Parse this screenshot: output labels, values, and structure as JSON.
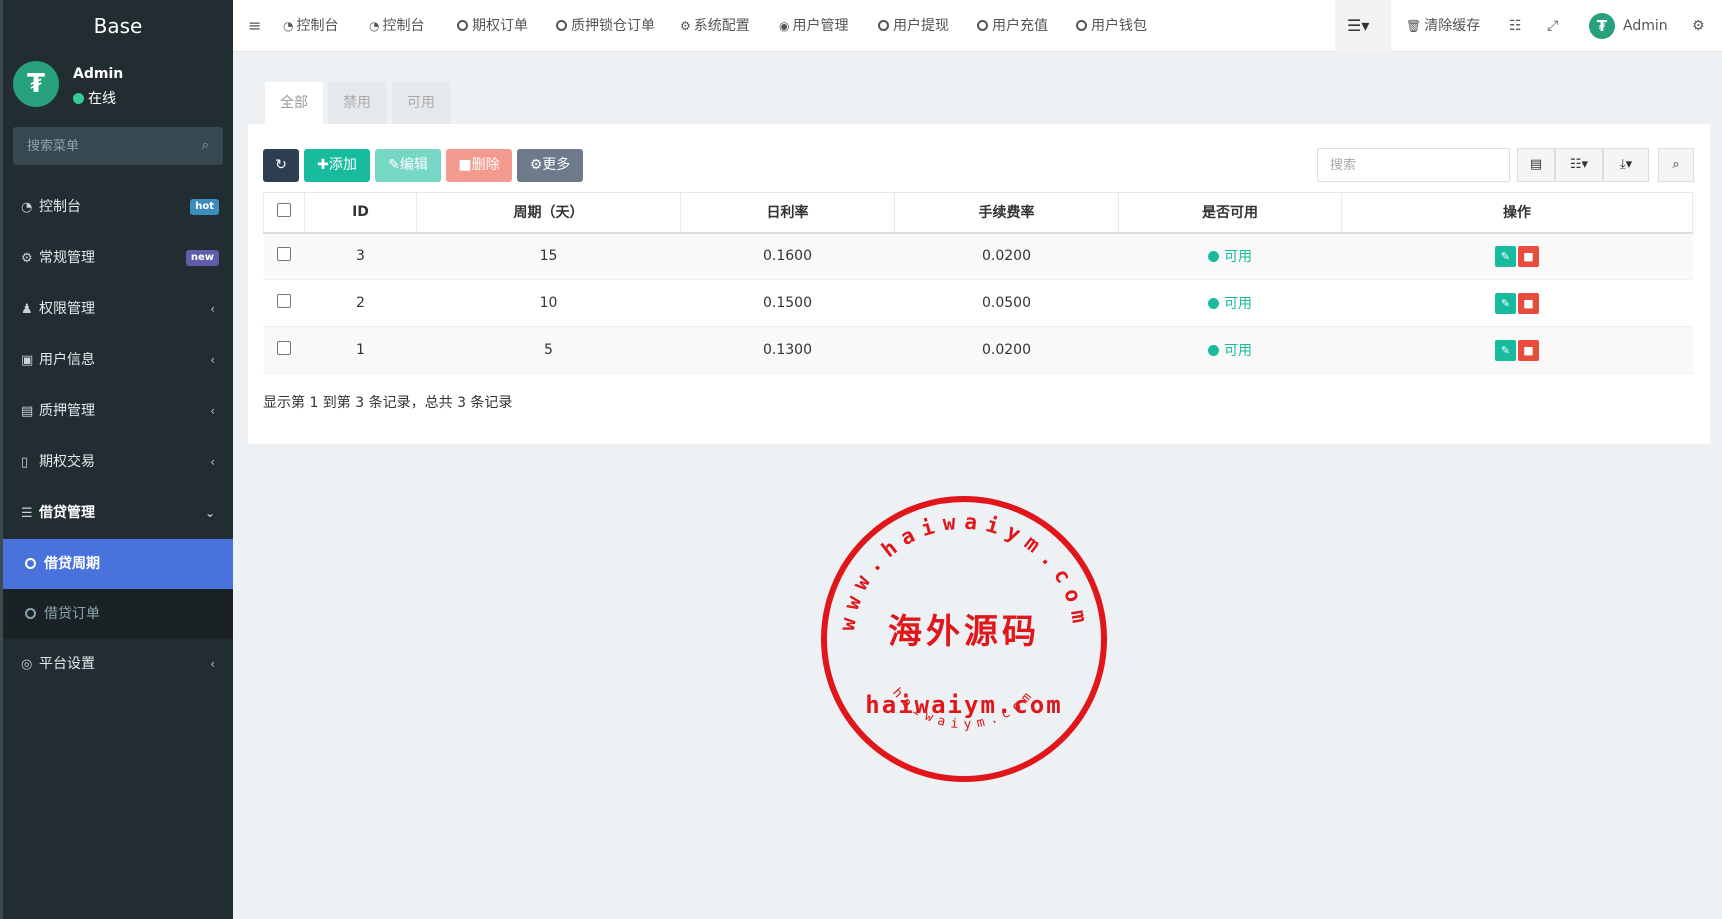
{
  "sidebar": {
    "brand": "Base",
    "user": {
      "name": "Admin",
      "status": "在线",
      "avatar_letter": "₮"
    },
    "search_placeholder": "搜索菜单",
    "menu": [
      {
        "label": "控制台",
        "icon": "dashboard-icon",
        "badge": "hot",
        "badge_color": "#3c8dbc"
      },
      {
        "label": "常规管理",
        "icon": "cogs-icon",
        "badge": "new",
        "badge_color": "#605ca8"
      },
      {
        "label": "权限管理",
        "icon": "group-icon"
      },
      {
        "label": "用户信息",
        "icon": "user-card-icon"
      },
      {
        "label": "质押管理",
        "icon": "newspaper-icon"
      },
      {
        "label": "期权交易",
        "icon": "document-icon"
      },
      {
        "label": "借贷管理",
        "icon": "list-icon"
      }
    ],
    "submenu": [
      {
        "label": "借贷周期",
        "active": true
      },
      {
        "label": "借贷订单",
        "active": false
      }
    ],
    "last_menu": {
      "label": "平台设置",
      "icon": "bullseye-icon"
    }
  },
  "topnav": {
    "items": [
      "控制台",
      "控制台",
      "期权订单",
      "质押锁仓订单",
      "系统配置",
      "用户管理",
      "用户提现",
      "用户充值",
      "用户钱包"
    ],
    "clear_cache": "清除缓存",
    "admin": "Admin"
  },
  "tabs": [
    "全部",
    "禁用",
    "可用"
  ],
  "toolbar": {
    "refresh_icon": "refresh-icon",
    "add": "添加",
    "edit": "编辑",
    "delete": "删除",
    "more": "更多",
    "search_placeholder": "搜索"
  },
  "table": {
    "headers": [
      "ID",
      "周期（天）",
      "日利率",
      "手续费率",
      "是否可用",
      "操作"
    ],
    "rows": [
      {
        "id": "3",
        "period": "15",
        "rate": "0.1600",
        "fee": "0.0200",
        "status": "可用"
      },
      {
        "id": "2",
        "period": "10",
        "rate": "0.1500",
        "fee": "0.0500",
        "status": "可用"
      },
      {
        "id": "1",
        "period": "5",
        "rate": "0.1300",
        "fee": "0.0200",
        "status": "可用"
      }
    ]
  },
  "pagination": {
    "info": "显示第 1 到第 3 条记录，总共 3 条记录"
  },
  "watermark": {
    "top": "www.haiwaiym.com",
    "center": "海外源码",
    "middle": "haiwaiym.com",
    "bottom": "haiwaiym.com"
  },
  "colors": {
    "sidebar_bg": "#222d32",
    "active_sub": "#4a72dd",
    "btn_refresh": "#2c3e50",
    "btn_add": "#18bc9c",
    "btn_edit": "#76d7c4",
    "btn_delete": "#f39a8e",
    "btn_more": "#6c7a89",
    "status_green": "#18bc9c",
    "op_edit": "#18bc9c",
    "op_delete": "#e74c3c",
    "stamp_red": "#e0161b"
  }
}
